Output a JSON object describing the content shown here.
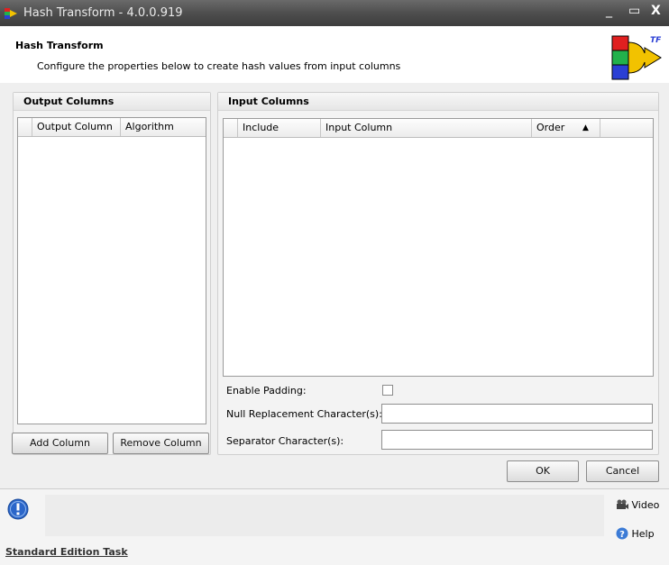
{
  "window": {
    "title": "Hash Transform - 4.0.0.919",
    "minimize_glyph": "_",
    "maximize_glyph": "▭",
    "close_glyph": "X"
  },
  "header": {
    "title": "Hash Transform",
    "description": "Configure the properties below to create hash values from input columns",
    "logo_text": "TF"
  },
  "output_panel": {
    "title": "Output Columns",
    "columns": [
      "Output Column",
      "Algorithm"
    ],
    "add_button": "Add Column",
    "remove_button": "Remove Column"
  },
  "input_panel": {
    "title": "Input Columns",
    "columns": [
      "Include",
      "Input Column",
      "Order"
    ],
    "sort_glyph": "▲",
    "enable_padding_label": "Enable Padding:",
    "enable_padding_checked": false,
    "null_replacement_label": "Null Replacement Character(s):",
    "null_replacement_value": "",
    "separator_label": "Separator Character(s):",
    "separator_value": ""
  },
  "dialog_buttons": {
    "ok": "OK",
    "cancel": "Cancel"
  },
  "footer": {
    "video_label": "Video",
    "help_label": "Help",
    "edition_link": "Standard Edition Task"
  },
  "colors": {
    "titlebar": "#4e4e4e",
    "logo_red": "#e02020",
    "logo_green": "#22b14c",
    "logo_blue": "#2a3fd4",
    "info_blue": "#2b66c9"
  }
}
